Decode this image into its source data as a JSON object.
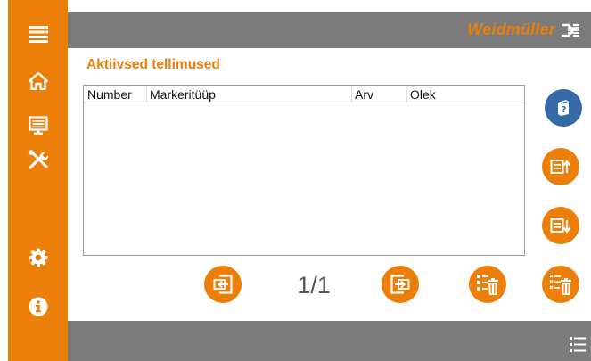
{
  "header": {
    "brand_name": "Weidmüller",
    "colors": {
      "accent": "#ec7f0a",
      "bar": "#7b7b7b",
      "help_button": "#356aa9"
    }
  },
  "sidebar": {
    "items": [
      {
        "icon": "hamburger-menu-icon"
      },
      {
        "icon": "home-icon"
      },
      {
        "icon": "monitor-icon"
      },
      {
        "icon": "tools-icon"
      },
      {
        "icon": "gear-icon"
      },
      {
        "icon": "info-icon"
      }
    ]
  },
  "main": {
    "title": "Aktiivsed tellimused",
    "table": {
      "columns": [
        "Number",
        "Markeritüüp",
        "Arv",
        "Olek"
      ],
      "rows": []
    },
    "pagination": {
      "label": "1/1"
    }
  },
  "right_actions": [
    {
      "icon": "help-document-icon"
    },
    {
      "icon": "move-up-icon"
    },
    {
      "icon": "move-down-icon"
    },
    {
      "icon": "delete-all-icon"
    }
  ],
  "bottom_actions": [
    {
      "icon": "previous-page-icon"
    },
    {
      "icon": "next-page-icon"
    },
    {
      "icon": "delete-icon"
    }
  ],
  "footer": {
    "icon": "list-menu-icon"
  }
}
